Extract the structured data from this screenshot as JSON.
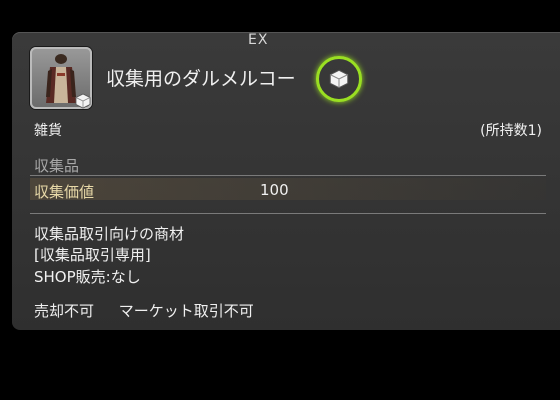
{
  "tooltip": {
    "tag": "EX",
    "item_name": "収集用のダルメルコート",
    "item_name_visible": "収集用のダルメルコー",
    "category": "雑貨",
    "owned": "(所持数1)",
    "section_header": "収集品",
    "stat": {
      "label": "収集価値",
      "value": "100"
    },
    "description": [
      "収集品取引向けの商材",
      "[収集品取引専用]",
      "SHOP販売:なし"
    ],
    "flags": [
      "売却不可",
      "マーケット取引不可"
    ],
    "icons": {
      "item": "dalmel-coat-icon",
      "collectable": "collectable-cube-icon"
    },
    "colors": {
      "highlight": "#9adf22",
      "panel": "#333333",
      "stat_label": "#e8d9a8"
    }
  }
}
